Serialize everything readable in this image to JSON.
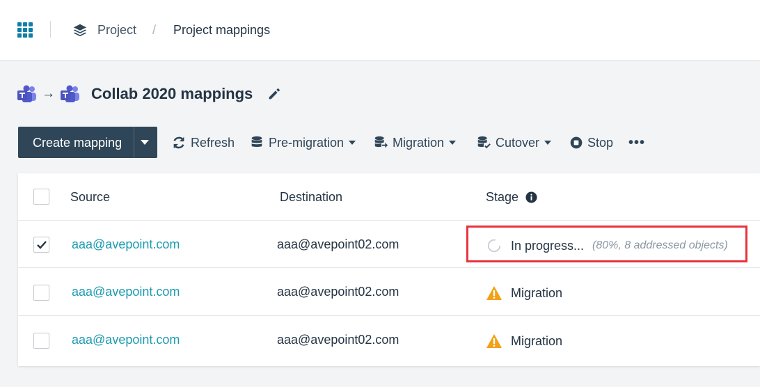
{
  "header": {
    "app_launcher_icon": "waffle-grid-icon",
    "breadcrumb": {
      "parent_icon": "layers-icon",
      "parent": "Project",
      "separator": "/",
      "current": "Project mappings"
    }
  },
  "title_row": {
    "source_icon": "teams-icon",
    "arrow": "→",
    "destination_icon": "teams-icon",
    "title": "Collab 2020 mappings",
    "edit_icon": "pencil-icon"
  },
  "toolbar": {
    "create_label": "Create mapping",
    "refresh_label": "Refresh",
    "premigration_label": "Pre-migration",
    "migration_label": "Migration",
    "cutover_label": "Cutover",
    "stop_label": "Stop",
    "more_label": "•••"
  },
  "table": {
    "columns": [
      "Source",
      "Destination",
      "Stage"
    ],
    "rows": [
      {
        "checked": true,
        "source": "aaa@avepoint.com",
        "destination": "aaa@avepoint02.com",
        "stage": "In progress...",
        "stage_detail": "(80%, 8 addressed objects)",
        "stage_icon": "spinner-icon"
      },
      {
        "checked": false,
        "source": "aaa@avepoint.com",
        "destination": "aaa@avepoint02.com",
        "stage": "Migration",
        "stage_icon": "warning-icon"
      },
      {
        "checked": false,
        "source": "aaa@avepoint.com",
        "destination": "aaa@avepoint02.com",
        "stage": "Migration",
        "stage_icon": "warning-icon"
      }
    ]
  },
  "colors": {
    "primary_button": "#2f4658",
    "link": "#1a9ab0",
    "highlight_border": "#e8323c",
    "warning": "#f2a116",
    "accent": "#0f7fa8"
  }
}
